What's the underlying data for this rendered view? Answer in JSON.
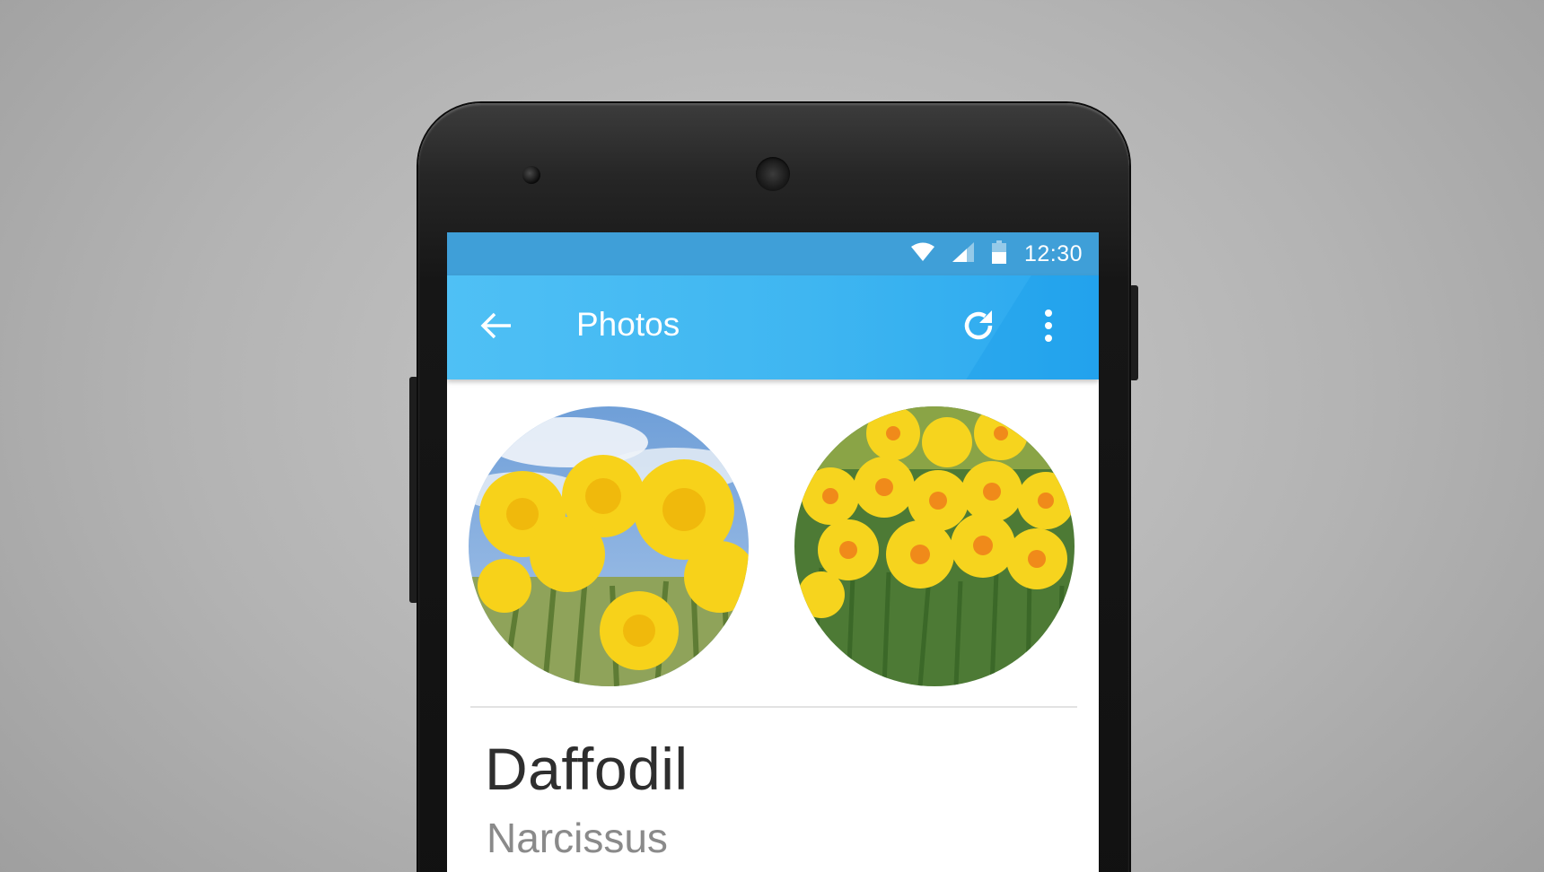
{
  "status_bar": {
    "time": "12:30",
    "icons": [
      "wifi-icon",
      "cell-signal-icon",
      "battery-icon"
    ]
  },
  "app_bar": {
    "title": "Photos",
    "icons": [
      "back-arrow-icon",
      "refresh-icon",
      "more-vert-icon"
    ]
  },
  "photos": [
    {
      "subject": "daffodils against blue sky"
    },
    {
      "subject": "field of daffodils with orange centers"
    }
  ],
  "plant": {
    "common_name": "Daffodil",
    "latin_name": "Narcissus"
  },
  "colors": {
    "status_bar": "#3f9fd8",
    "app_bar": "#3fb6f1",
    "title_text": "#ffffff",
    "primary_text": "#2e2e2e",
    "secondary_text": "#8a8a8a"
  }
}
